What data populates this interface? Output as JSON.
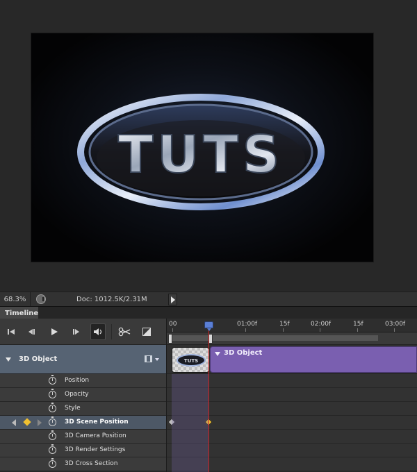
{
  "status_bar": {
    "zoom": "68.3%",
    "doc_info": "Doc: 1012.5K/2.31M"
  },
  "panel": {
    "tab_label": "Timeline"
  },
  "canvas": {
    "logo_text": "TUTS"
  },
  "ruler": {
    "labels": [
      "00",
      "01:00f",
      "15f",
      "02:00f",
      "15f",
      "03:00f"
    ]
  },
  "layer": {
    "name": "3D Object",
    "clip_name": "3D Object"
  },
  "properties": [
    {
      "label": "Position"
    },
    {
      "label": "Opacity"
    },
    {
      "label": "Style"
    },
    {
      "label": "3D Scene Position",
      "selected": true
    },
    {
      "label": "3D Camera Position"
    },
    {
      "label": "3D Render Settings"
    },
    {
      "label": "3D Cross Section"
    }
  ],
  "colors": {
    "clip": "#7a5fb0",
    "layer_header": "#566373",
    "playhead": "#d02020",
    "keyframe": "#f0c030"
  },
  "icons": {
    "controls": [
      "go-to-first-frame-icon",
      "previous-frame-icon",
      "play-icon",
      "next-frame-icon",
      "audio-icon",
      "split-scissors-icon",
      "transition-icon"
    ]
  }
}
